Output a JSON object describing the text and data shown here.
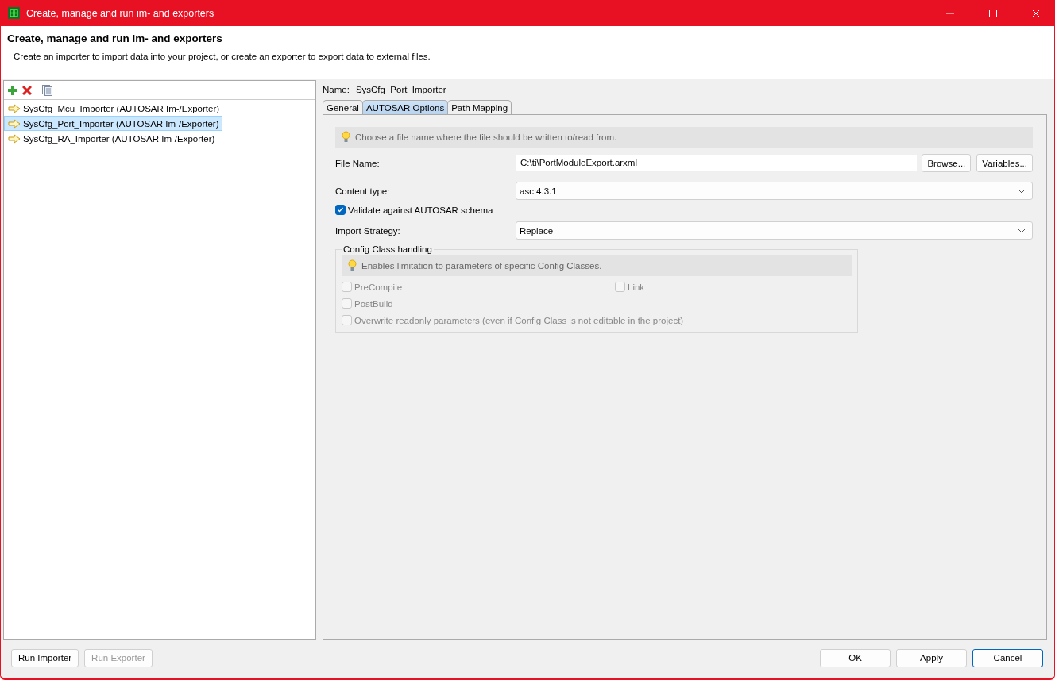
{
  "window": {
    "title": "Create, manage and run im- and exporters"
  },
  "header": {
    "title": "Create, manage and run im- and exporters",
    "description": "Create an importer to import data into your project, or create an exporter to export data to external files."
  },
  "importers": [
    {
      "label": "SysCfg_Mcu_Importer (AUTOSAR Im-/Exporter)",
      "selected": false
    },
    {
      "label": "SysCfg_Port_Importer (AUTOSAR Im-/Exporter)",
      "selected": true
    },
    {
      "label": "SysCfg_RA_Importer (AUTOSAR Im-/Exporter)",
      "selected": false
    }
  ],
  "details": {
    "name_label": "Name:",
    "name_value": "SysCfg_Port_Importer",
    "tabs": [
      {
        "label": "General",
        "selected": false
      },
      {
        "label": "AUTOSAR Options",
        "selected": true
      },
      {
        "label": "Path Mapping",
        "selected": false
      }
    ],
    "hint": "Choose a file name where the file should be written to/read from.",
    "file_name": {
      "label": "File Name:",
      "value": "C:\\ti\\PortModuleExport.arxml",
      "buttons": [
        "Browse...",
        "Variables..."
      ]
    },
    "content_type": {
      "label": "Content type:",
      "value": "asc:4.3.1"
    },
    "validate": {
      "label": "Validate against AUTOSAR schema",
      "checked": true
    },
    "import_strategy": {
      "label": "Import Strategy:",
      "value": "Replace"
    },
    "config_group": {
      "title": "Config Class handling",
      "hint": "Enables limitation to parameters of specific Config Classes.",
      "options": [
        {
          "label": "PreCompile",
          "checked": false,
          "disabled": true,
          "kind": "narrow"
        },
        {
          "label": "Link",
          "checked": false,
          "disabled": true,
          "kind": "narrow"
        },
        {
          "label": "PostBuild",
          "checked": false,
          "disabled": true,
          "kind": "narrow"
        },
        {
          "label": "Overwrite readonly parameters (even if Config Class is not editable in the project)",
          "checked": false,
          "disabled": true,
          "kind": "wide"
        }
      ]
    }
  },
  "left_buttons": [
    {
      "label": "Run Importer",
      "disabled": false
    },
    {
      "label": "Run Exporter",
      "disabled": true
    }
  ],
  "right_buttons": [
    {
      "label": "OK",
      "default": false
    },
    {
      "label": "Apply",
      "default": false
    },
    {
      "label": "Cancel",
      "default": true
    }
  ]
}
